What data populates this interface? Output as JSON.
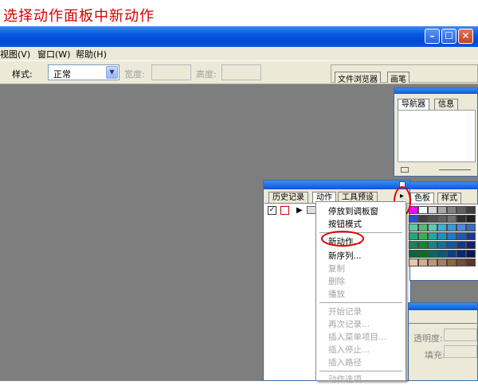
{
  "caption": "选择动作面板中新动作",
  "window": {
    "min": "–",
    "max": "☐",
    "close": "✕"
  },
  "menubar": {
    "view": "视图(V)",
    "window": "窗口(W)",
    "help": "帮助(H)"
  },
  "options": {
    "style_label": "样式:",
    "style_value": "正常",
    "width_label": "宽度:",
    "height_label": "高度:",
    "tab_file_browser": "文件浏览器",
    "tab_brush": "画笔"
  },
  "nav_panel": {
    "tab_navigator": "导航器",
    "tab_info": "信息"
  },
  "actions_panel": {
    "tab_history": "历史记录",
    "tab_actions": "动作",
    "tab_tool_presets": "工具预设"
  },
  "swatch_panel": {
    "tab_color": "色板",
    "tab_style": "样式"
  },
  "layers_panel": {
    "opacity_label": "透明度:",
    "fill_label": "填充:"
  },
  "context_menu": {
    "dock": "停放到调板窗",
    "button_mode": "按钮模式",
    "new_action": "新动作...",
    "new_set": "新序列...",
    "duplicate": "复制",
    "delete": "删除",
    "play": "播放",
    "start_recording": "开始记录",
    "record_again": "再次记录...",
    "insert_menu_item": "插入菜单项目...",
    "insert_stop": "插入停止...",
    "insert_path": "插入路径",
    "action_options": "动作选项..."
  },
  "colors": {
    "accent": "#0a56dc",
    "annotation": "#e00000",
    "canvas": "#7e7e7e",
    "panel": "#ece9d8"
  }
}
